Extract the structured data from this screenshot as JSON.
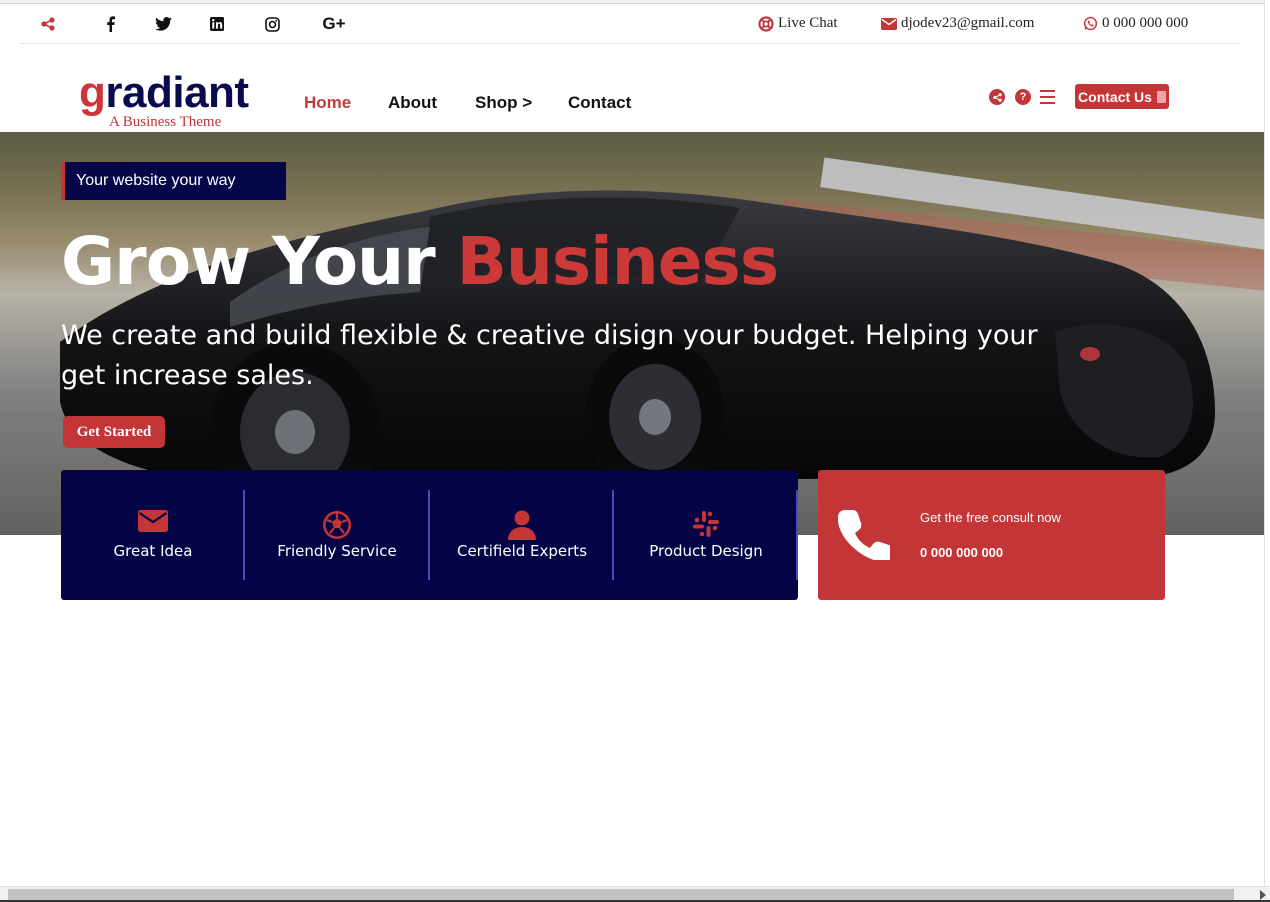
{
  "colors": {
    "brand_red": "#c43538",
    "navy": "#030345",
    "text_dark": "#111111"
  },
  "topbar": {
    "social_icons": [
      "share-icon",
      "facebook-icon",
      "twitter-icon",
      "linkedin-icon",
      "instagram-icon",
      "google-plus-icon"
    ],
    "google_plus_label": "G+",
    "live_chat": "Live Chat",
    "email": "djodev23@gmail.com",
    "phone": "0 000 000 000"
  },
  "header": {
    "logo_first": "g",
    "logo_rest": "radiant",
    "logo_tagline": "A Business Theme",
    "nav": [
      {
        "label": "Home",
        "active": true
      },
      {
        "label": "About"
      },
      {
        "label": "Shop >"
      },
      {
        "label": "Contact"
      }
    ],
    "icons": [
      "share-icon",
      "help-icon",
      "menu-icon"
    ],
    "help_glyph": "?",
    "contact_button": "Contact Us"
  },
  "hero": {
    "tagline": "Your website your way",
    "title_plain": "Grow Your ",
    "title_accent": "Business",
    "subtitle": "We create and build flexible & creative disign your budget. Helping your get increase sales.",
    "cta": "Get Started"
  },
  "features": [
    {
      "icon": "envelope-icon",
      "label": "Great Idea"
    },
    {
      "icon": "soccer-ball-icon",
      "label": "Friendly Service"
    },
    {
      "icon": "user-icon",
      "label": "Certifield Experts"
    },
    {
      "icon": "slack-icon",
      "label": "Product Design"
    }
  ],
  "consult": {
    "icon": "phone-icon",
    "title": "Get the free consult now",
    "phone": "0 000 000 000"
  }
}
